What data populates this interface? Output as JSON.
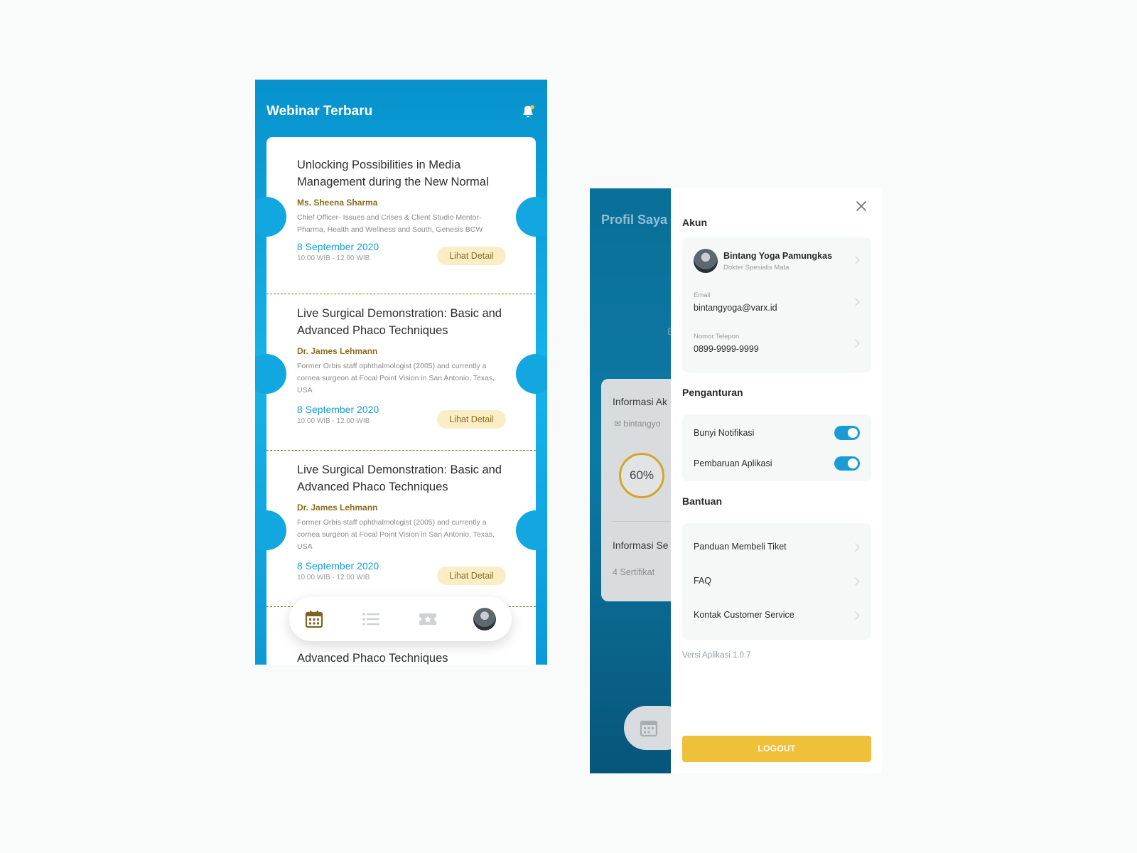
{
  "left_screen": {
    "title": "Webinar Terbaru",
    "cards": [
      {
        "title": "Unlocking Possibilities in Media Management during the New Normal",
        "speaker": "Ms. Sheena Sharma",
        "description": "Chief Officer- Issues and Crises & Client Studio Mentor- Pharma, Health and Wellness and South, Genesis BCW",
        "date": "8 September 2020",
        "time": "10:00 WIB - 12.00 WIB",
        "button": "Lihat Detail"
      },
      {
        "title": "Live Surgical Demonstration: Basic and Advanced Phaco Techniques",
        "speaker": "Dr. James Lehmann",
        "description": "Former Orbis staff ophthalmologist (2005) and currently a cornea surgeon at Focal Point Vision in San Antonio, Texas, USA",
        "date": "8 September 2020",
        "time": "10:00 WIB - 12.00 WIB",
        "button": "Lihat Detail"
      },
      {
        "title": "Live Surgical Demonstration: Basic and Advanced Phaco Techniques",
        "speaker": "Dr. James Lehmann",
        "description": "Former Orbis staff ophthalmologist (2005) and currently a cornea surgeon at Focal Point Vision in San Antonio, Texas, USA",
        "date": "8 September 2020",
        "time": "10:00 WIB - 12.00 WIB",
        "button": "Lihat Detail"
      }
    ],
    "partial_card_title": "Advanced Phaco Techniques",
    "bottom_nav": [
      "calendar-icon",
      "list-icon",
      "ticket-icon",
      "avatar"
    ]
  },
  "right_screen": {
    "background": {
      "title": "Profil Saya",
      "stray_letter": "E",
      "card_info_title": "Informasi Ak",
      "card_email": "bintangyo",
      "progress_label": "60%",
      "card_cert_title": "Informasi Se",
      "card_cert_count": "4 Sertifikat"
    },
    "drawer": {
      "section_account": "Akun",
      "user_name": "Bintang Yoga Pamungkas",
      "user_role": "Dokter Spesialis Mata",
      "email_label": "Email",
      "email_value": "bintangyoga@varx.id",
      "phone_label": "Nomor Telepon",
      "phone_value": "0899-9999-9999",
      "section_settings": "Penganturan",
      "settings": [
        {
          "label": "Bunyi Notifikasi",
          "on": true
        },
        {
          "label": "Pembaruan Aplikasi",
          "on": true
        }
      ],
      "section_help": "Bantuan",
      "help_items": [
        "Panduan Membeli Tiket",
        "FAQ",
        "Kontak Customer Service"
      ],
      "version": "Versi Aplikasi 1.0.7",
      "logout": "LOGOUT"
    }
  },
  "colors": {
    "primary_blue": "#16b3ea",
    "gold_text": "#8a6d1d",
    "badge_bg": "#fbeec6",
    "toggle_on": "#1b9bd6",
    "logout_bg": "#efc13b"
  }
}
